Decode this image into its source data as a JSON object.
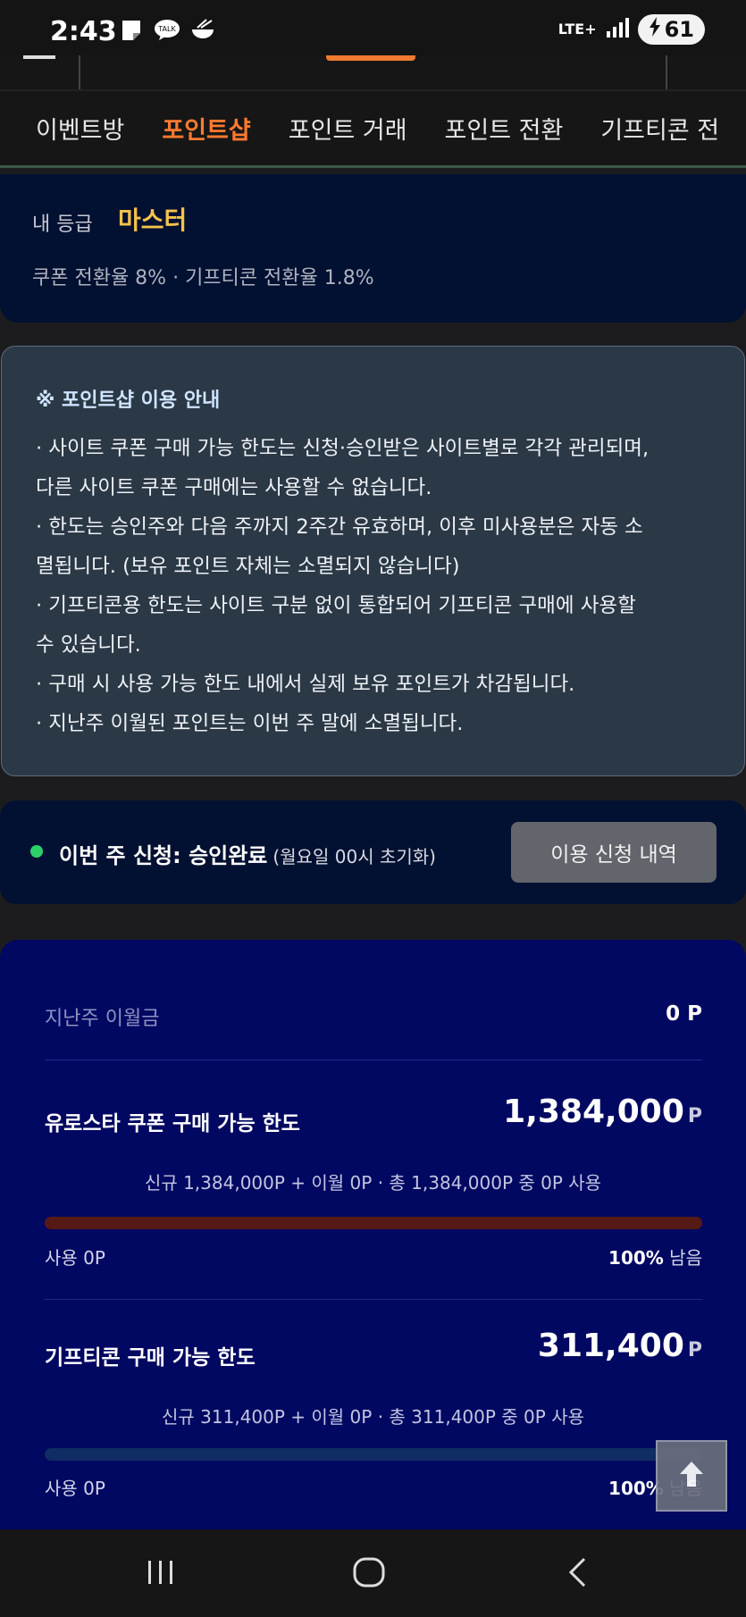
{
  "status_bar": {
    "time": "2:43",
    "talk_badge": "TALK",
    "network": "LTE+",
    "battery": "61"
  },
  "tabs": [
    {
      "label": "이벤트방",
      "active": false
    },
    {
      "label": "포인트샵",
      "active": true
    },
    {
      "label": "포인트 거래",
      "active": false
    },
    {
      "label": "포인트 전환",
      "active": false
    },
    {
      "label": "기프티콘 전",
      "active": false
    }
  ],
  "grade": {
    "label": "내 등급",
    "value": "마스터",
    "rates": "쿠폰 전환율 8% · 기프티콘 전환율 1.8%"
  },
  "notice": {
    "title": "※ 포인트샵 이용 안내",
    "lines": [
      " · 사이트 쿠폰 구매 가능 한도는 신청·승인받은 사이트별로 각각 관리되며,",
      "다른 사이트 쿠폰 구매에는 사용할 수 없습니다.",
      " · 한도는 승인주와 다음 주까지 2주간 유효하며, 이후 미사용분은 자동 소",
      "멸됩니다. (보유 포인트 자체는 소멸되지 않습니다)",
      " · 기프티콘용 한도는 사이트 구분 없이 통합되어 기프티콘 구매에 사용할",
      "수 있습니다.",
      " · 구매 시 사용 가능 한도 내에서 실제 보유 포인트가 차감됩니다.",
      " · 지난주 이월된 포인트는 이번 주 말에 소멸됩니다."
    ]
  },
  "apply": {
    "status": "이번 주 신청: 승인완료",
    "reset_note": "(월요일 00시 초기화)",
    "button": "이용 신청 내역"
  },
  "limits": {
    "last_week_label": "지난주 이월금",
    "last_week_value": "0 P",
    "unit": "P",
    "coupon": {
      "title": "유로스타 쿠폰 구매 가능 한도",
      "amount": "1,384,000",
      "desc": "신규 1,384,000P + 이월 0P · 총 1,384,000P 중 0P 사용",
      "used": "사용 0P",
      "remain_pct": "100%",
      "remain_word": " 남음",
      "used_fraction": 0
    },
    "gifticon": {
      "title": "기프티콘 구매 가능 한도",
      "amount": "311,400",
      "desc": "신규 311,400P + 이월 0P · 총 311,400P 중 0P 사용",
      "used": "사용 0P",
      "remain_pct": "100%",
      "remain_word": " 남음",
      "used_fraction": 0
    }
  },
  "icons": {
    "scroll_top": "arrow-up-icon",
    "nav_recent": "recent-apps-icon",
    "nav_home": "home-icon",
    "nav_back": "back-icon"
  }
}
